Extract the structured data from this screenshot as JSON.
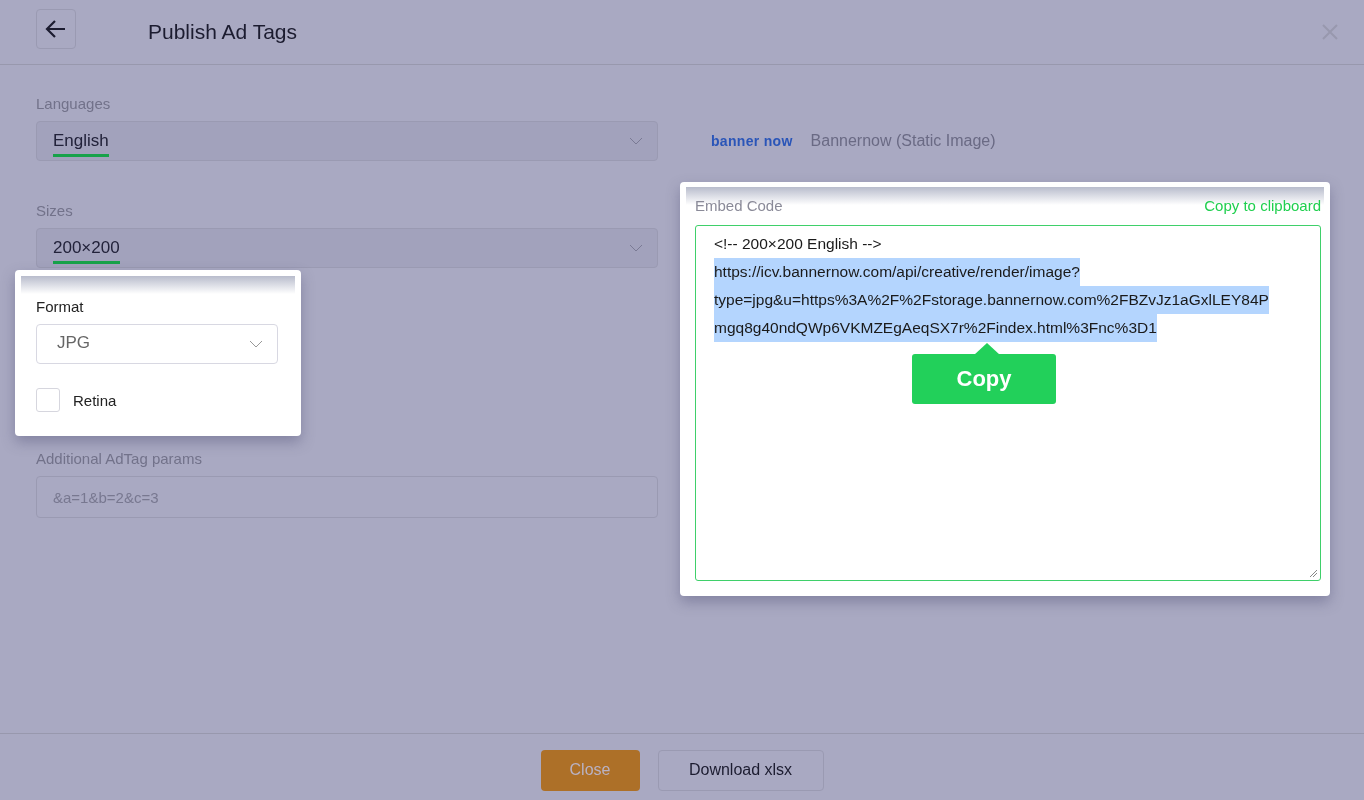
{
  "header": {
    "title": "Publish Ad Tags"
  },
  "languages": {
    "label": "Languages",
    "value": "English"
  },
  "sizes": {
    "label": "Sizes",
    "value": "200×200"
  },
  "format": {
    "label": "Format",
    "value": "JPG"
  },
  "retina": {
    "label": "Retina",
    "checked": false
  },
  "params": {
    "label": "Additional AdTag params",
    "placeholder": "&a=1&b=2&c=3"
  },
  "provider": {
    "logo_first": "banner",
    "logo_second": "now",
    "name": "Bannernow (Static Image)"
  },
  "embed": {
    "label": "Embed Code",
    "copy_link": "Copy to clipboard",
    "comment": "<!-- 200×200 English -->",
    "url_lines": [
      "https://icv.bannernow.com/api/creative/render/image?",
      "type=jpg&u=https%3A%2F%2Fstorage.bannernow.com%2FBZvJz1aGxlLEY84P",
      "mgq8g40ndQWp6VKMZEgAeqSX7r%2Findex.html%3Fnc%3D1"
    ],
    "highlighted": true,
    "tooltip": "Copy"
  },
  "footer": {
    "buttons": [
      {
        "label": "Close",
        "kind": "primary"
      },
      {
        "label": "Download xlsx",
        "kind": "secondary"
      }
    ]
  }
}
